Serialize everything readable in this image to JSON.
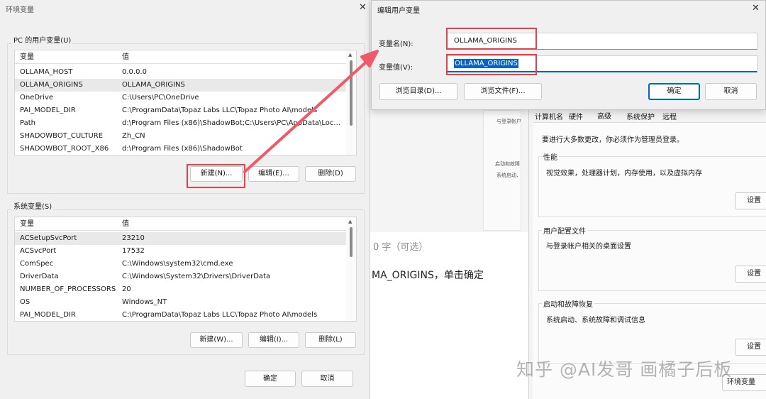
{
  "env_dialog": {
    "title": "环境变量",
    "user_group_label": "PC 的用户变量(U)",
    "user_columns": [
      "变量",
      "值"
    ],
    "user_rows": [
      [
        "OLLAMA_HOST",
        "0.0.0.0"
      ],
      [
        "OLLAMA_ORIGINS",
        "OLLAMA_ORIGINS"
      ],
      [
        "OneDrive",
        "C:\\Users\\PC\\OneDrive"
      ],
      [
        "PAI_MODEL_DIR",
        "C:\\ProgramData\\Topaz Labs LLC\\Topaz Photo AI\\models"
      ],
      [
        "Path",
        "d:\\Program Files (x86)\\ShadowBot;C:\\Users\\PC\\AppData\\Loc..."
      ],
      [
        "SHADOWBOT_CULTURE",
        "Zh_CN"
      ],
      [
        "SHADOWBOT_ROOT_X86",
        "d:\\Program Files (x86)\\ShadowBot"
      ]
    ],
    "user_buttons": {
      "new": "新建(N)...",
      "edit": "编辑(E)...",
      "delete": "删除(D)"
    },
    "system_group_label": "系统变量(S)",
    "system_columns": [
      "变量",
      "值"
    ],
    "system_rows": [
      [
        "ACSetupSvcPort",
        "23210"
      ],
      [
        "ACSvcPort",
        "17532"
      ],
      [
        "ComSpec",
        "C:\\Windows\\system32\\cmd.exe"
      ],
      [
        "DriverData",
        "C:\\Windows\\System32\\Drivers\\DriverData"
      ],
      [
        "NUMBER_OF_PROCESSORS",
        "20"
      ],
      [
        "OS",
        "Windows_NT"
      ],
      [
        "PAI_MODEL_DIR",
        "C:\\ProgramData\\Topaz Labs LLC\\Topaz Photo AI\\models"
      ]
    ],
    "system_buttons": {
      "new": "新建(W)...",
      "edit": "编辑(I)...",
      "delete": "删除(L)"
    },
    "ok": "确定",
    "cancel": "取消"
  },
  "edit_dialog": {
    "title": "编辑用户变量",
    "name_label": "变量名(N):",
    "name_value": "OLLAMA_ORIGINS",
    "value_label": "变量值(V):",
    "value_value": "OLLAMA_ORIGINS",
    "browse_dir": "浏览目录(D)...",
    "browse_file": "浏览文件(F)...",
    "ok": "确定",
    "cancel": "取消"
  },
  "sys_props": {
    "tabs": [
      "计算机名",
      "硬件",
      "高级",
      "系统保护",
      "远程"
    ],
    "admin_note": "要进行大多数更改，你必须作为管理员登录。",
    "perf_title": "性能",
    "perf_desc": "视觉效果，处理器计划，内存使用，以及虚拟内存",
    "profile_title": "用户配置文件",
    "profile_desc": "与登录帐户相关的桌面设置",
    "startup_title": "启动和故障恢复",
    "startup_desc": "系统启动、系统故障和调试信息",
    "settings_btn": "设置",
    "env_btn": "环境变量"
  },
  "background": {
    "optional_hint": "0 字（可选）",
    "instruction": "MA_ORIGINS，单击确定",
    "snip_1": "与登录帐户",
    "snip_2": "启动和故障",
    "snip_3": "系统启动、"
  },
  "watermark": "知乎 @AI发哥 画橘子后板",
  "colors": {
    "highlight": "#e8404a",
    "selection": "#0a64c8",
    "focus": "#0067c0"
  }
}
